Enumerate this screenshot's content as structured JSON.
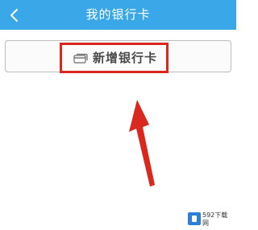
{
  "header": {
    "title": "我的银行卡",
    "back_icon": "chevron-left-icon",
    "background_color": "#3aa8e8"
  },
  "main": {
    "add_card_label": "新增银行卡",
    "add_card_icon": "card-icon",
    "highlight_color": "#d9281e"
  },
  "annotation": {
    "arrow_icon": "arrow-up-icon",
    "arrow_color": "#d9281e"
  },
  "watermark": {
    "text": "592下载网",
    "icon": "logo-icon"
  }
}
